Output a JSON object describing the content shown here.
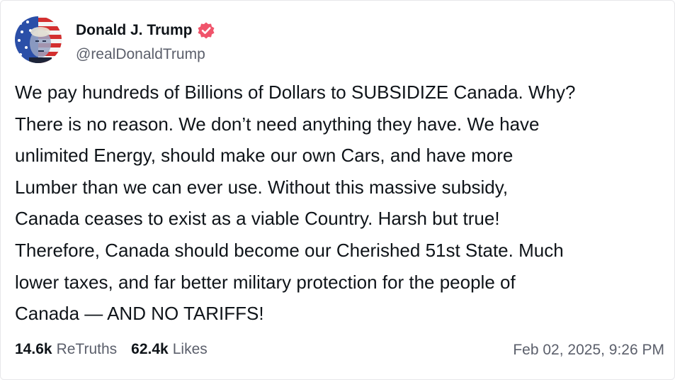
{
  "author": {
    "display_name": "Donald J. Trump",
    "handle": "@realDonaldTrump",
    "verified_badge_color": "#f0546b",
    "avatar_icon": "avatar-image"
  },
  "post": {
    "lines": [
      "We pay hundreds of Billions of Dollars to SUBSIDIZE Canada. Why?",
      "There is no reason. We don’t need anything they have. We have",
      "unlimited Energy, should make our own Cars, and have more",
      "Lumber than we can ever use. Without this massive subsidy,",
      "Canada ceases to exist as a viable Country. Harsh but true!",
      "Therefore, Canada should become our Cherished 51st State. Much",
      "lower taxes, and far better military protection for the people of",
      "Canada — AND NO TARIFFS!"
    ]
  },
  "stats": {
    "retruths_count": "14.6k",
    "retruths_label": "ReTruths",
    "likes_count": "62.4k",
    "likes_label": "Likes"
  },
  "timestamp": "Feb 02, 2025, 9:26 PM",
  "colors": {
    "text": "#0f1419",
    "muted": "#5b5f6b",
    "border": "#e7e7ea"
  }
}
